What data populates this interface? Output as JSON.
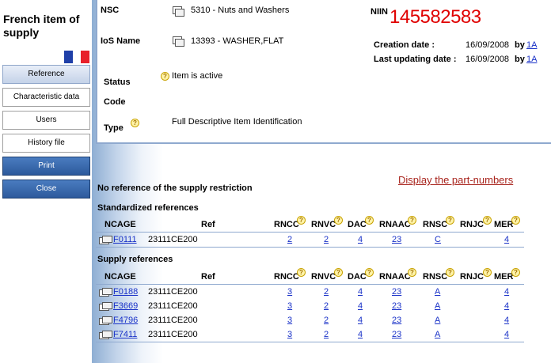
{
  "sidebar": {
    "title": "French item of supply",
    "flag_colors": [
      "#1f3fa8",
      "#ffffff",
      "#e8202a"
    ],
    "reference": "Reference",
    "characteristic": "Characteristic data",
    "users": "Users",
    "history": "History file",
    "print": "Print",
    "close": "Close"
  },
  "info": {
    "nsc_label": "NSC",
    "nsc_value": "5310 - Nuts and Washers",
    "ios_label": "IoS Name",
    "ios_value": "13393 - WASHER,FLAT",
    "status_label": "Status",
    "status_value": "Item is active",
    "code_label": "Code",
    "type_label": "Type",
    "type_value": "Full Descriptive Item Identification",
    "niin_label": "NIIN",
    "niin_value": "145582583",
    "creation_label": "Creation date :",
    "creation_value": "16/09/2008",
    "updating_label": "Last updating date :",
    "updating_value": "16/09/2008",
    "by": "by",
    "by_link": "1A"
  },
  "main": {
    "no_ref": "No reference of the supply restriction",
    "display_pn": "Display the part-numbers",
    "std_title": "Standardized references",
    "sup_title": "Supply references",
    "headers": [
      "NCAGE",
      "Ref",
      "RNCC",
      "RNVC",
      "DAC",
      "RNAAC",
      "RNSC",
      "RNJC",
      "MER"
    ]
  },
  "standardized": [
    {
      "ncage": "F0111",
      "ref": "23111CE200",
      "rncc": "2",
      "rnvc": "2",
      "dac": "4",
      "rnaac": "23",
      "rnsc": "C",
      "rnjc": "",
      "mer": "4"
    }
  ],
  "supply": [
    {
      "ncage": "F0188",
      "ref": "23111CE200",
      "rncc": "3",
      "rnvc": "2",
      "dac": "4",
      "rnaac": "23",
      "rnsc": "A",
      "rnjc": "",
      "mer": "4"
    },
    {
      "ncage": "F3669",
      "ref": "23111CE200",
      "rncc": "3",
      "rnvc": "2",
      "dac": "4",
      "rnaac": "23",
      "rnsc": "A",
      "rnjc": "",
      "mer": "4"
    },
    {
      "ncage": "F4796",
      "ref": "23111CE200",
      "rncc": "3",
      "rnvc": "2",
      "dac": "4",
      "rnaac": "23",
      "rnsc": "A",
      "rnjc": "",
      "mer": "4"
    },
    {
      "ncage": "F7411",
      "ref": "23111CE200",
      "rncc": "3",
      "rnvc": "2",
      "dac": "4",
      "rnaac": "23",
      "rnsc": "A",
      "rnjc": "",
      "mer": "4"
    }
  ]
}
